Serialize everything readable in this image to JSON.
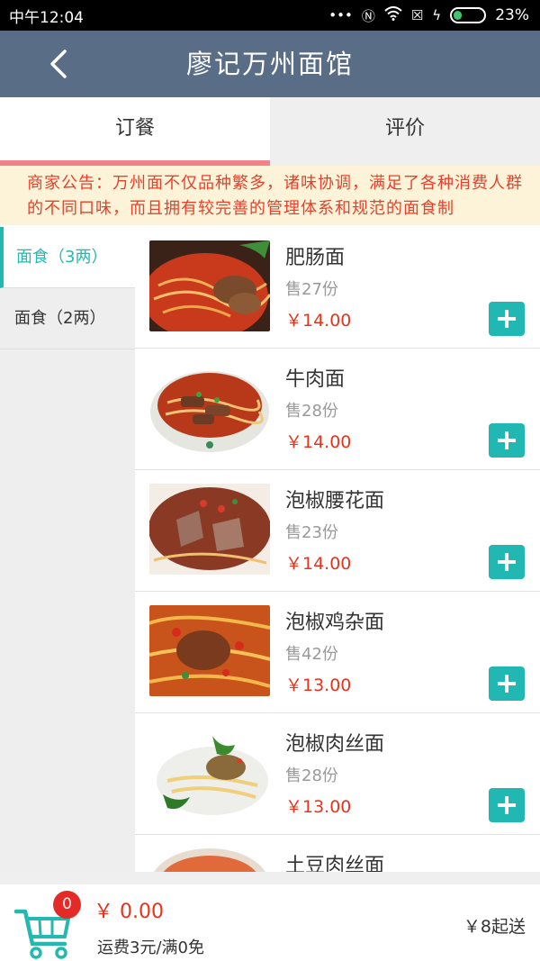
{
  "status_bar": {
    "time": "中午12:04",
    "icons": [
      "more-icon",
      "nfc-icon",
      "wifi-icon",
      "sim-icon",
      "charging-icon"
    ],
    "battery": "23%"
  },
  "header": {
    "back_icon": "chevron-left-icon",
    "title": "廖记万州面馆"
  },
  "tabs": [
    {
      "label": "订餐",
      "active": true
    },
    {
      "label": "评价",
      "active": false
    }
  ],
  "notice": "商家公告：万州面不仅品种繁多，诸味协调，满足了各种消费人群的不同口味，而且拥有较完善的管理体系和规范的面食制",
  "categories": [
    {
      "label": "面食（3两）",
      "active": true
    },
    {
      "label": "面食（2两）",
      "active": false
    }
  ],
  "products": [
    {
      "name": "肥肠面",
      "sold": "售27份",
      "price": "￥14.00"
    },
    {
      "name": "牛肉面",
      "sold": "售28份",
      "price": "￥14.00"
    },
    {
      "name": "泡椒腰花面",
      "sold": "售23份",
      "price": "￥14.00"
    },
    {
      "name": "泡椒鸡杂面",
      "sold": "售42份",
      "price": "￥13.00"
    },
    {
      "name": "泡椒肉丝面",
      "sold": "售28份",
      "price": "￥13.00"
    },
    {
      "name": "土豆肉丝面",
      "sold": "",
      "price": ""
    }
  ],
  "cart": {
    "icon": "cart-icon",
    "badge": "0",
    "total": "￥ 0.00",
    "delivery_fee": "运费3元/满0免",
    "min_order": "￥8起送"
  },
  "colors": {
    "header_bg": "#5a6d87",
    "accent": "#21b8b3",
    "price_red": "#e8331c",
    "tab_indicator": "#f2828a",
    "notice_bg": "#fdf3d8"
  }
}
